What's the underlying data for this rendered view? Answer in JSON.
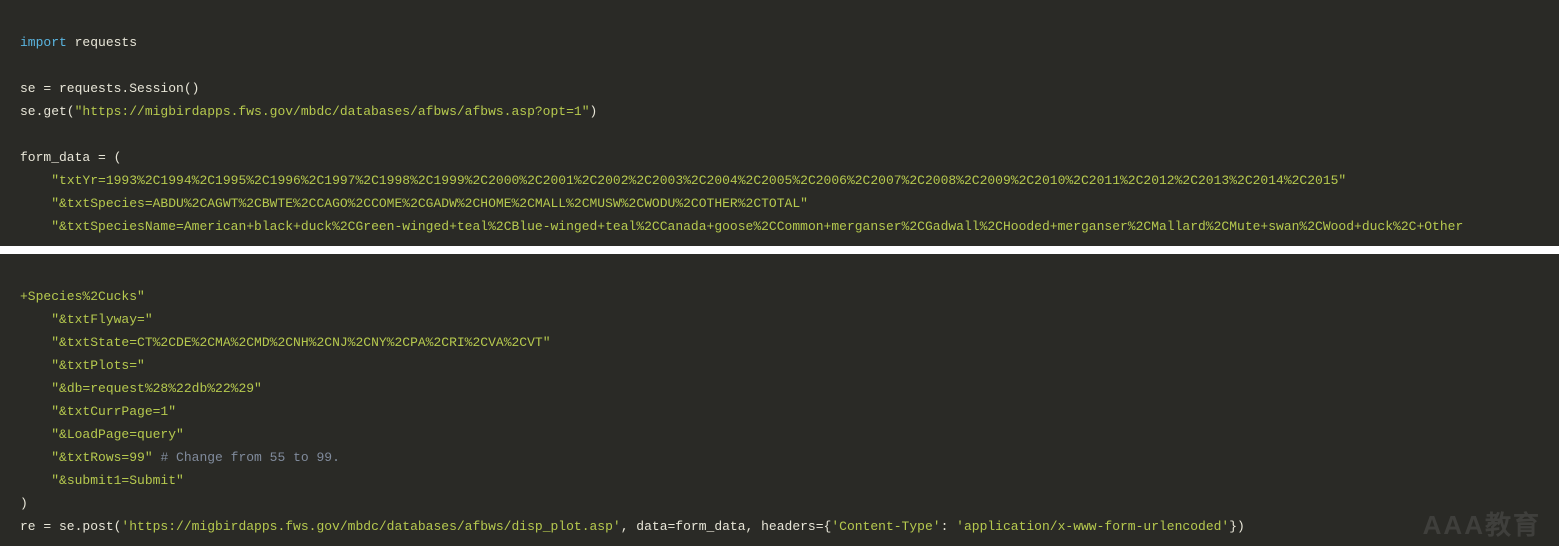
{
  "block1": {
    "l1_kw": "import",
    "l1_mod": " requests",
    "blank1": "",
    "l2": "se = requests.Session()",
    "l3_a": "se.get(",
    "l3_s": "\"https://migbirdapps.fws.gov/mbdc/databases/afbws/afbws.asp?opt=1\"",
    "l3_b": ")",
    "blank2": "",
    "l4": "form_data = (",
    "l5_s": "\"txtYr=1993%2C1994%2C1995%2C1996%2C1997%2C1998%2C1999%2C2000%2C2001%2C2002%2C2003%2C2004%2C2005%2C2006%2C2007%2C2008%2C2009%2C2010%2C2011%2C2012%2C2013%2C2014%2C2015\"",
    "l6_s": "\"&txtSpecies=ABDU%2CAGWT%2CBWTE%2CCAGO%2CCOME%2CGADW%2CHOME%2CMALL%2CMUSW%2CWODU%2COTHER%2CTOTAL\"",
    "l7_s": "\"&txtSpeciesName=American+black+duck%2CGreen-winged+teal%2CBlue-winged+teal%2CCanada+goose%2CCommon+merganser%2CGadwall%2CHooded+merganser%2CMallard%2CMute+swan%2CWood+duck%2C+Other"
  },
  "block2": {
    "l8_s": "+Species%2Cucks\"",
    "l9_s": "\"&txtFlyway=\"",
    "l10_s": "\"&txtState=CT%2CDE%2CMA%2CMD%2CNH%2CNJ%2CNY%2CPA%2CRI%2CVA%2CVT\"",
    "l11_s": "\"&txtPlots=\"",
    "l12_s": "\"&db=request%28%22db%22%29\"",
    "l13_s": "\"&txtCurrPage=1\"",
    "l14_s": "\"&LoadPage=query\"",
    "l15_s": "\"&txtRows=99\"",
    "l15_c": " # Change from 55 to 99.",
    "l16_s": "\"&submit1=Submit\"",
    "l17": ")",
    "l18_a": "re = se.post(",
    "l18_s1": "'https://migbirdapps.fws.gov/mbdc/databases/afbws/disp_plot.asp'",
    "l18_b": ", data=form_data, headers={",
    "l18_s2": "'Content-Type'",
    "l18_c": ": ",
    "l18_s3": "'application/x-www-form-urlencoded'",
    "l18_d": "})"
  },
  "indent": "    ",
  "watermark": "AAA教育"
}
